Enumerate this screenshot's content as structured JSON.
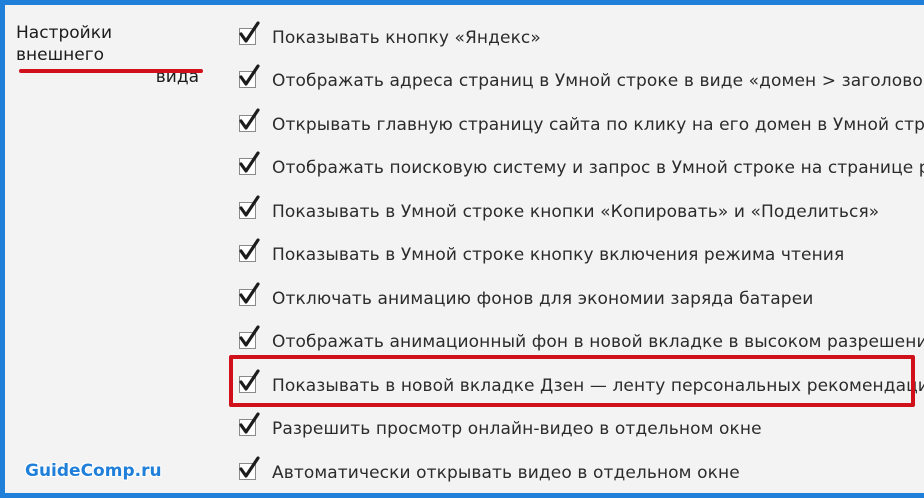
{
  "section": {
    "title_line1": "Настройки внешнего",
    "title_line2": "вида"
  },
  "options": [
    {
      "label": "Показывать кнопку «Яндекс»",
      "checked": true
    },
    {
      "label": "Отображать адреса страниц в Умной строке в виде «домен > заголовок»",
      "checked": true
    },
    {
      "label": "Открывать главную страницу сайта по клику на его домен в Умной строке",
      "checked": true
    },
    {
      "label": "Отображать поисковую систему и запрос в Умной строке на странице результатов",
      "checked": true
    },
    {
      "label": "Показывать в Умной строке кнопки «Копировать» и «Поделиться»",
      "checked": true
    },
    {
      "label": "Показывать в Умной строке кнопку включения режима чтения",
      "checked": true
    },
    {
      "label": "Отключать анимацию фонов для экономии заряда батареи",
      "checked": true
    },
    {
      "label": "Отображать анимационный фон в новой вкладке в высоком разрешении",
      "checked": true
    },
    {
      "label": "Показывать в новой вкладке Дзен — ленту персональных рекомендаций",
      "checked": true,
      "highlighted": true
    },
    {
      "label": "Разрешить просмотр онлайн-видео в отдельном окне",
      "checked": true
    },
    {
      "label": "Автоматически открывать видео в отдельном окне",
      "checked": true
    }
  ],
  "watermark": "GuideComp.ru",
  "colors": {
    "frame_border": "#1f7fd9",
    "highlight": "#d0101b",
    "background": "#f3f3f3"
  }
}
